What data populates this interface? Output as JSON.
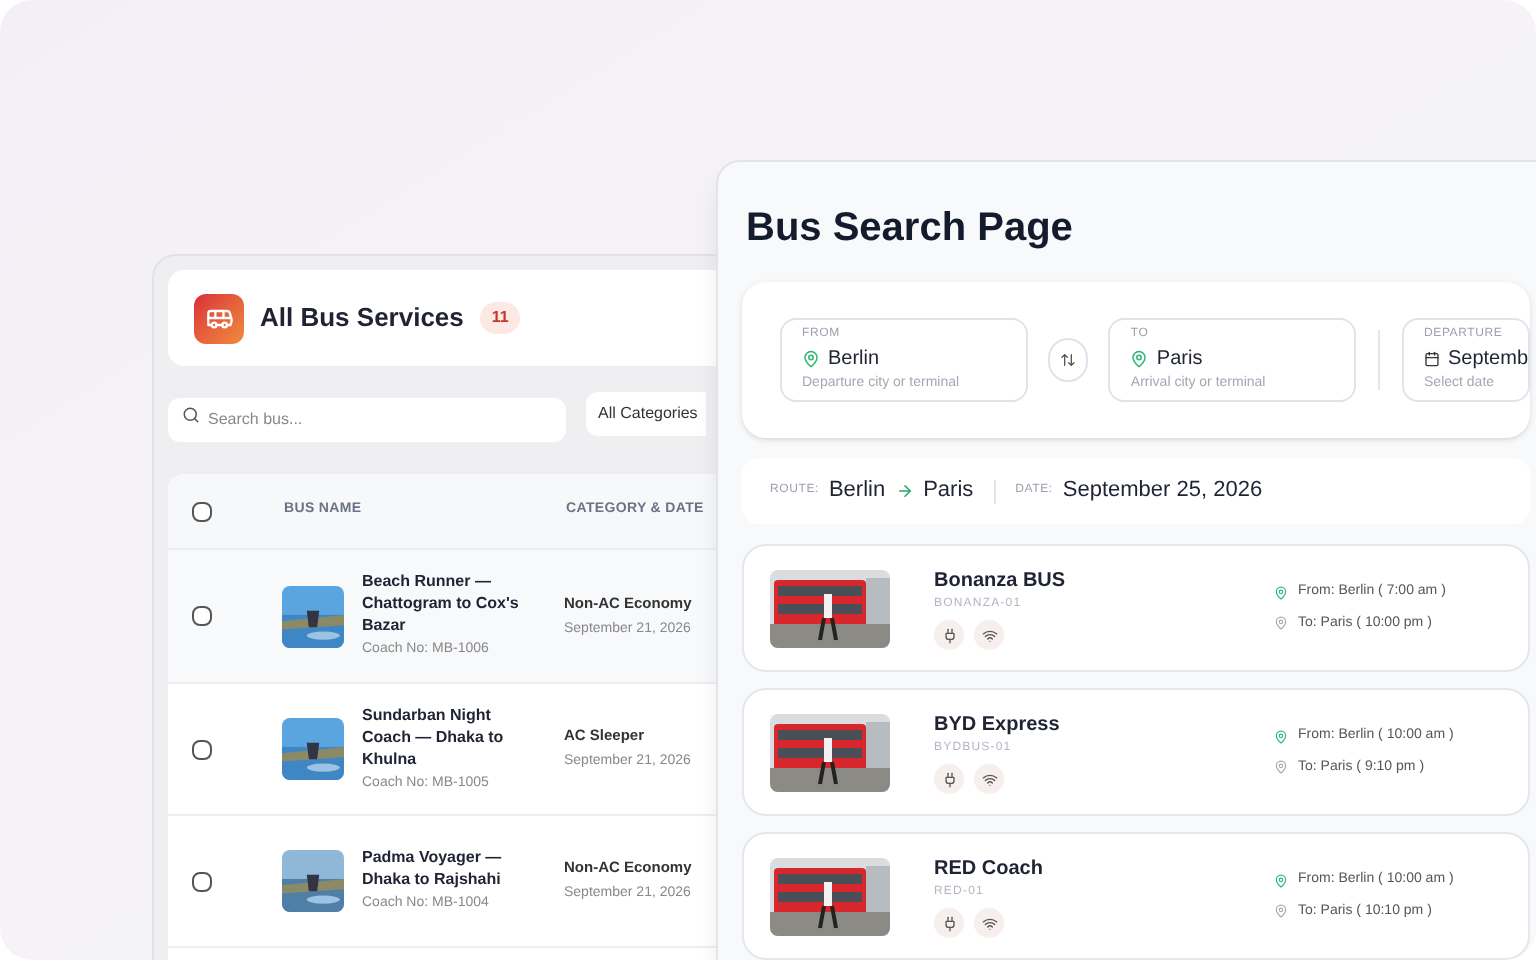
{
  "services": {
    "title": "All Bus Services",
    "count": "11",
    "search": {
      "placeholder": "Search bus..."
    },
    "category_filter": "All Categories",
    "columns": [
      "BUS NAME",
      "CATEGORY & DATE"
    ],
    "all_checked": false,
    "rows": [
      {
        "name": "Beach Runner — Chattogram to Cox's Bazar",
        "coach": "Coach No: MB-1006",
        "category": "Non-AC Economy",
        "date": "September 21, 2026",
        "checked": false,
        "kind": "picture"
      },
      {
        "name": "Sundarban Night Coach — Dhaka to Khulna",
        "coach": "Coach No: MB-1005",
        "category": "AC Sleeper",
        "date": "September 21, 2026",
        "checked": false,
        "kind": "picture"
      },
      {
        "name": "Padma Voyager — Dhaka to Rajshahi",
        "coach": "Coach No: MB-1004",
        "category": "Non-AC Economy",
        "date": "September 21, 2026",
        "checked": false,
        "kind": "picture"
      }
    ]
  },
  "search_page": {
    "title": "Bus Search Page",
    "fields": [
      {
        "label": "FROM",
        "value": "Berlin",
        "hint": "Departure city or terminal",
        "kind": "place"
      },
      {
        "label": "TO",
        "value": "Paris",
        "hint": "Arrival city or terminal",
        "kind": "place"
      },
      {
        "label": "DEPARTURE",
        "value": "Septemb",
        "hint": "Select date",
        "kind": "date"
      }
    ],
    "route_label": "ROUTE:",
    "route_from": "Berlin",
    "route_to": "Paris",
    "date_label": "DATE:",
    "date": "September 25, 2026",
    "results": [
      {
        "name": "Bonanza BUS",
        "code": "BONANZA-01",
        "from": "From: Berlin ( 7:00 am )",
        "to": "To: Paris ( 10:00 pm )"
      },
      {
        "name": "BYD Express",
        "code": "BYDBUS-01",
        "from": "From: Berlin ( 10:00 am )",
        "to": "To: Paris ( 9:10 pm )"
      },
      {
        "name": "RED Coach",
        "code": "RED-01",
        "from": "From: Berlin ( 10:00 am )",
        "to": "To: Paris ( 10:10 pm )"
      }
    ]
  }
}
